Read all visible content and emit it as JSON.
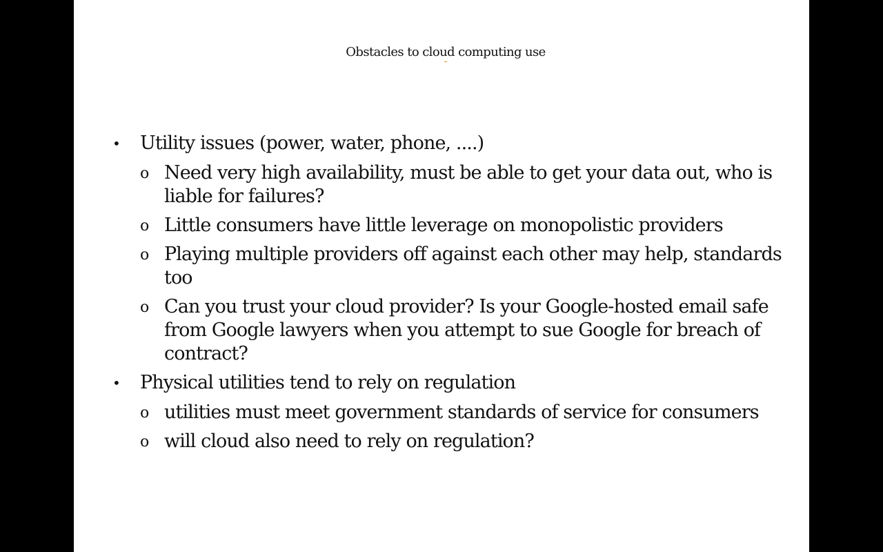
{
  "slide": {
    "title": "Obstacles to cloud computing use",
    "bullet_marker": "•",
    "sub_marker": "o",
    "items": [
      {
        "text": "Utility issues (power, water, phone, ....)",
        "children": [
          "Need very high availability, must be able to get your data out, who is liable for failures?",
          "Little consumers have little leverage on monopolistic providers",
          "Playing multiple providers off against each other may help, standards too",
          "Can you trust your cloud provider? Is your Google-hosted email safe from Google lawyers when you attempt to sue Google for breach of contract?"
        ]
      },
      {
        "text": "Physical utilities tend to rely on regulation",
        "children": [
          "utilities must meet government standards of service for consumers",
          "will cloud also need to rely on regulation?"
        ]
      }
    ]
  }
}
